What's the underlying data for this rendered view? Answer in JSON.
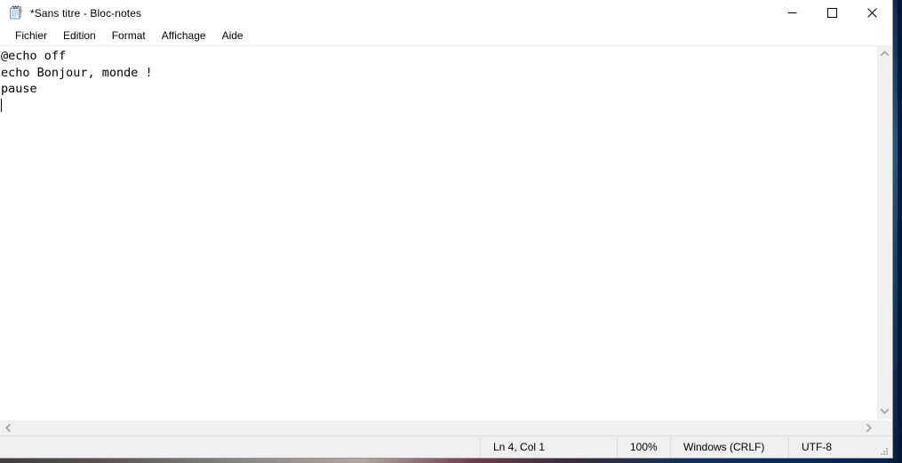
{
  "window": {
    "title": "*Sans titre - Bloc-notes",
    "icon": "notepad-icon",
    "controls": {
      "minimize": "—",
      "maximize": "☐",
      "close": "✕"
    }
  },
  "menubar": {
    "items": [
      {
        "label": "Fichier"
      },
      {
        "label": "Edition"
      },
      {
        "label": "Format"
      },
      {
        "label": "Affichage"
      },
      {
        "label": "Aide"
      }
    ]
  },
  "editor": {
    "lines": [
      "@echo off",
      "echo Bonjour, monde !",
      "pause"
    ],
    "text": "@echo off\necho Bonjour, monde !\npause\n",
    "caret_line": 4,
    "caret_column": 1
  },
  "scrollbars": {
    "vertical": {
      "up_arrow": "▲",
      "down_arrow": "▼"
    },
    "horizontal": {
      "left_arrow": "◀",
      "right_arrow": "▶"
    }
  },
  "statusbar": {
    "position": "Ln 4, Col 1",
    "zoom": "100%",
    "line_ending": "Windows (CRLF)",
    "encoding": "UTF-8"
  },
  "colors": {
    "window_background": "#ffffff",
    "chrome_background": "#f0f0f0",
    "text": "#000000",
    "separator": "#dcdcdc",
    "scrollbar_arrow": "#a0a0a0",
    "close_hover": "#e81123"
  }
}
